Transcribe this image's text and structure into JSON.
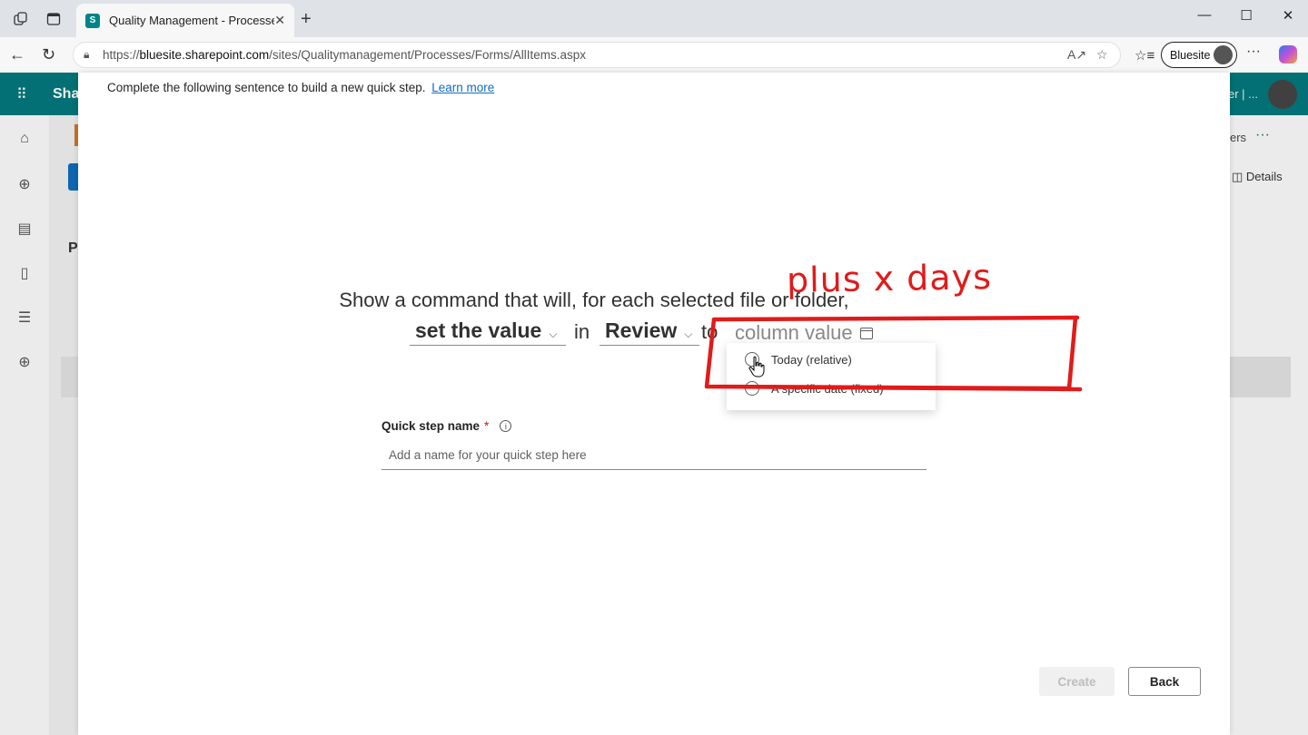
{
  "browser": {
    "tab_title": "Quality Management - Processes",
    "tab_favicon_letter": "S",
    "url_host": "bluesite.sharepoint.com",
    "url_prefix": "https://",
    "url_path": "/sites/Qualitymanagement/Processes/Forms/AllItems.aspx",
    "profile_name": "Bluesite"
  },
  "sharepoint": {
    "brand": "Sha",
    "header_truncated": "er | ...",
    "right_text": "ers",
    "details_label": "Details",
    "left_letter": "P"
  },
  "panel": {
    "intro_text": "Complete the following sentence to build a new quick step.",
    "learn_more": "Learn more",
    "sentence_line1": "Show a command that will, for each selected file or folder,",
    "action_value": "set the value",
    "word_in": "in",
    "column_value": "Review",
    "word_to": "to",
    "value_placeholder": "column value",
    "menu_options": [
      "Today (relative)",
      "A specific date (fixed)"
    ],
    "annotation": "plus x days",
    "annotation_color": "#e01b1b",
    "quick_step_label": "Quick step name",
    "required_mark": "*",
    "quick_step_placeholder": "Add a name for your quick step here",
    "create_label": "Create",
    "back_label": "Back"
  }
}
